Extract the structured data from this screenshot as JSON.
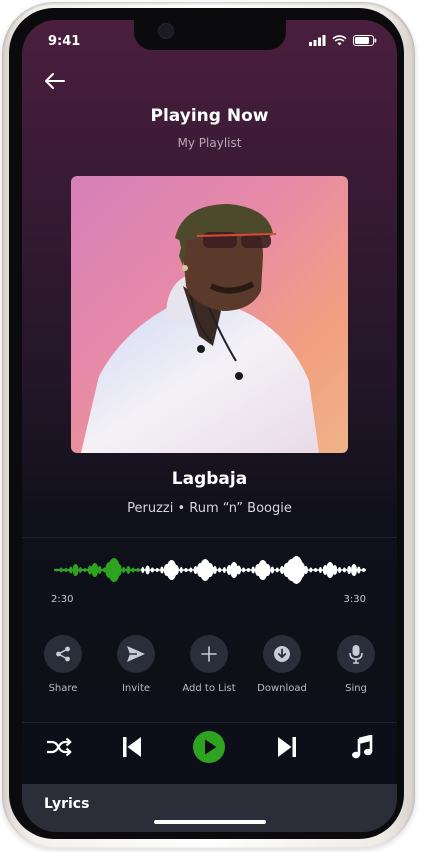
{
  "status_bar": {
    "time": "9:41"
  },
  "header": {
    "title": "Playing Now",
    "subtitle": "My Playlist"
  },
  "track": {
    "title": "Lagbaja",
    "artist_line": "Peruzzi • Rum “n” Boogie"
  },
  "progress": {
    "elapsed": "2:30",
    "total": "3:30",
    "played_fraction": 0.28
  },
  "colors": {
    "accent": "#2ea31f",
    "background_top": "#4a1f3e",
    "background_bottom": "#0c0f18"
  },
  "actions": [
    {
      "label": "Share",
      "icon": "share-icon"
    },
    {
      "label": "Invite",
      "icon": "send-icon"
    },
    {
      "label": "Add to List",
      "icon": "plus-icon"
    },
    {
      "label": "Download",
      "icon": "download-icon"
    },
    {
      "label": "Sing",
      "icon": "microphone-icon"
    }
  ],
  "controls": [
    "shuffle-icon",
    "previous-icon",
    "play-icon",
    "next-icon",
    "music-note-icon"
  ],
  "lyrics": {
    "label": "Lyrics"
  }
}
